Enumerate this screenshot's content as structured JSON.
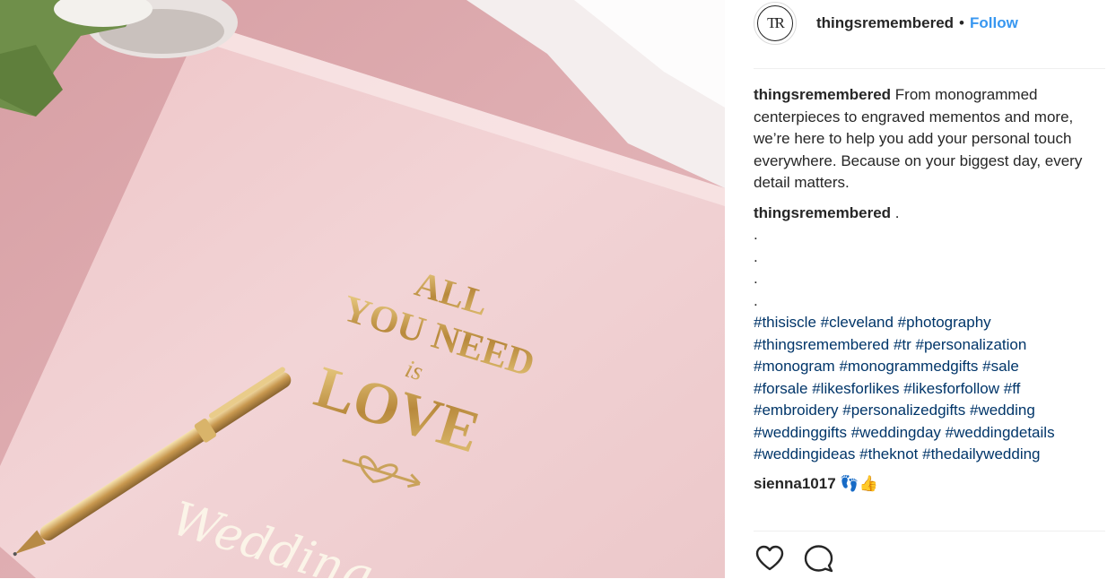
{
  "post_image": {
    "book_lines": [
      "ALL",
      "YOU NEED",
      "is",
      "LOVE"
    ],
    "script_text": "Wedding"
  },
  "header": {
    "username": "thingsremembered",
    "separator": "•",
    "follow_label": "Follow",
    "avatar_monogram": "TR"
  },
  "caption": {
    "username": "thingsremembered",
    "text": "From monogrammed centerpieces to engraved mementos and more, we’re here to help you add your personal touch everywhere. Because on your biggest day, every detail matters."
  },
  "comments": [
    {
      "username": "thingsremembered",
      "first": ".",
      "dots": [
        ".",
        ".",
        ".",
        "."
      ],
      "hashtags": [
        [
          "#thisiscle",
          "#cleveland",
          "#photography"
        ],
        [
          "#thingsremembered",
          "#tr",
          "#personalization"
        ],
        [
          "#monogram",
          "#monogrammedgifts",
          "#sale"
        ],
        [
          "#forsale",
          "#likesforlikes",
          "#likesforfollow",
          "#ff"
        ],
        [
          "#embroidery",
          "#personalizedgifts",
          "#wedding"
        ],
        [
          "#weddinggifts",
          "#weddingday",
          "#weddingdetails"
        ],
        [
          "#weddingideas",
          "#theknot",
          "#thedailywedding"
        ]
      ]
    },
    {
      "username": "sienna1017",
      "text": "👣👍"
    }
  ],
  "actions": {
    "like_icon": "heart-outline-icon",
    "comment_icon": "speech-bubble-icon"
  },
  "colors": {
    "link": "#003569",
    "follow": "#3897f0",
    "text": "#262626"
  }
}
